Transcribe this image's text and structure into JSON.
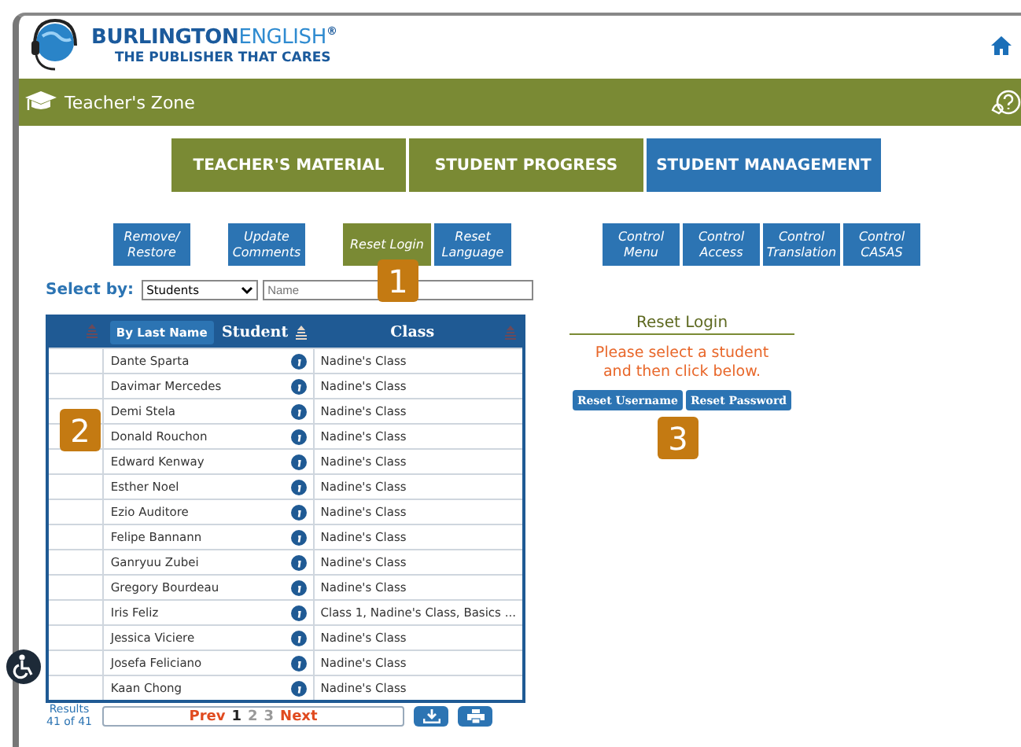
{
  "brand": {
    "name_part1": "BURLINGTON",
    "name_part2": "ENGLISH",
    "registered": "®",
    "tagline": "THE PUBLISHER THAT CARES"
  },
  "zone_bar": {
    "title": "Teacher's Zone"
  },
  "tabs": [
    {
      "label": "TEACHER'S MATERIAL",
      "selected": false
    },
    {
      "label": "STUDENT PROGRESS",
      "selected": false
    },
    {
      "label": "STUDENT MANAGEMENT",
      "selected": true
    }
  ],
  "actions_left": [
    {
      "label": "Remove/ Restore",
      "selected": false
    },
    {
      "label": "Update Comments",
      "selected": false
    },
    {
      "label": "Reset Login",
      "selected": true
    },
    {
      "label": "Reset Language",
      "selected": false
    }
  ],
  "actions_right": [
    {
      "label": "Control Menu",
      "selected": false
    },
    {
      "label": "Control Access",
      "selected": false
    },
    {
      "label": "Control Translation",
      "selected": false
    },
    {
      "label": "Control CASAS",
      "selected": false
    }
  ],
  "select_by": {
    "label": "Select by:",
    "value": "Students",
    "placeholder": "Name"
  },
  "table": {
    "sort_button": "By Last Name",
    "columns": [
      "Student",
      "Class"
    ],
    "rows": [
      {
        "student": "Dante Sparta",
        "class": "Nadine's Class"
      },
      {
        "student": "Davimar Mercedes",
        "class": "Nadine's Class"
      },
      {
        "student": "Demi Stela",
        "class": "Nadine's Class"
      },
      {
        "student": "Donald Rouchon",
        "class": "Nadine's Class"
      },
      {
        "student": "Edward Kenway",
        "class": "Nadine's Class"
      },
      {
        "student": "Esther Noel",
        "class": "Nadine's Class"
      },
      {
        "student": "Ezio Auditore",
        "class": "Nadine's Class"
      },
      {
        "student": "Felipe Bannann",
        "class": "Nadine's Class"
      },
      {
        "student": "Ganryuu Zubei",
        "class": "Nadine's Class"
      },
      {
        "student": "Gregory Bourdeau",
        "class": "Nadine's Class"
      },
      {
        "student": "Iris Feliz",
        "class": "Class 1, Nadine's Class, Basics ..."
      },
      {
        "student": "Jessica Viciere",
        "class": "Nadine's Class"
      },
      {
        "student": "Josefa Feliciano",
        "class": "Nadine's Class"
      },
      {
        "student": "Kaan Chong",
        "class": "Nadine's Class"
      }
    ]
  },
  "pagination": {
    "results_label": "Results",
    "results_count": "41 of 41",
    "prev": "Prev",
    "next": "Next",
    "pages": [
      {
        "label": "1",
        "selected": true
      },
      {
        "label": "2",
        "selected": false
      },
      {
        "label": "3",
        "selected": false
      }
    ]
  },
  "reset_panel": {
    "title": "Reset Login",
    "message": "Please select a student and then click below.",
    "buttons": [
      "Reset Username",
      "Reset Password"
    ]
  },
  "callouts": [
    {
      "label": "1"
    },
    {
      "label": "2"
    },
    {
      "label": "3"
    }
  ]
}
